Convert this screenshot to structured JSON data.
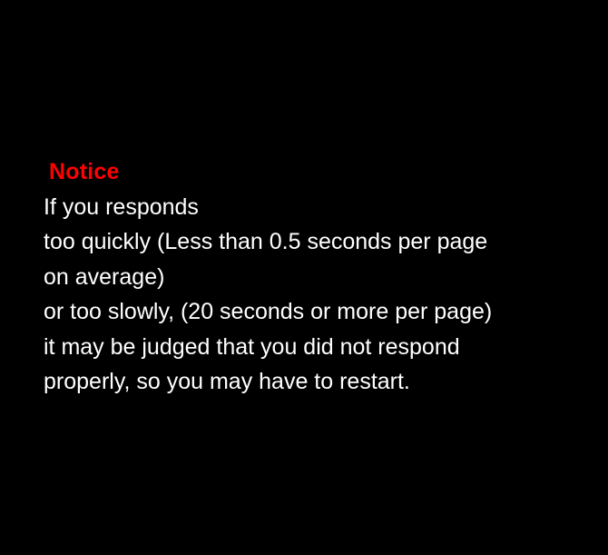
{
  "notice": {
    "title": "Notice",
    "title_color": "#ff0000",
    "text_color": "#ffffff",
    "background_color": "#000000",
    "lines": [
      "If you responds",
      "too quickly (Less than 0.5 seconds per page",
      "on average)",
      "or too slowly, (20 seconds or more per page)",
      "it may be judged that you did not respond",
      "properly, so you may have to restart."
    ]
  }
}
